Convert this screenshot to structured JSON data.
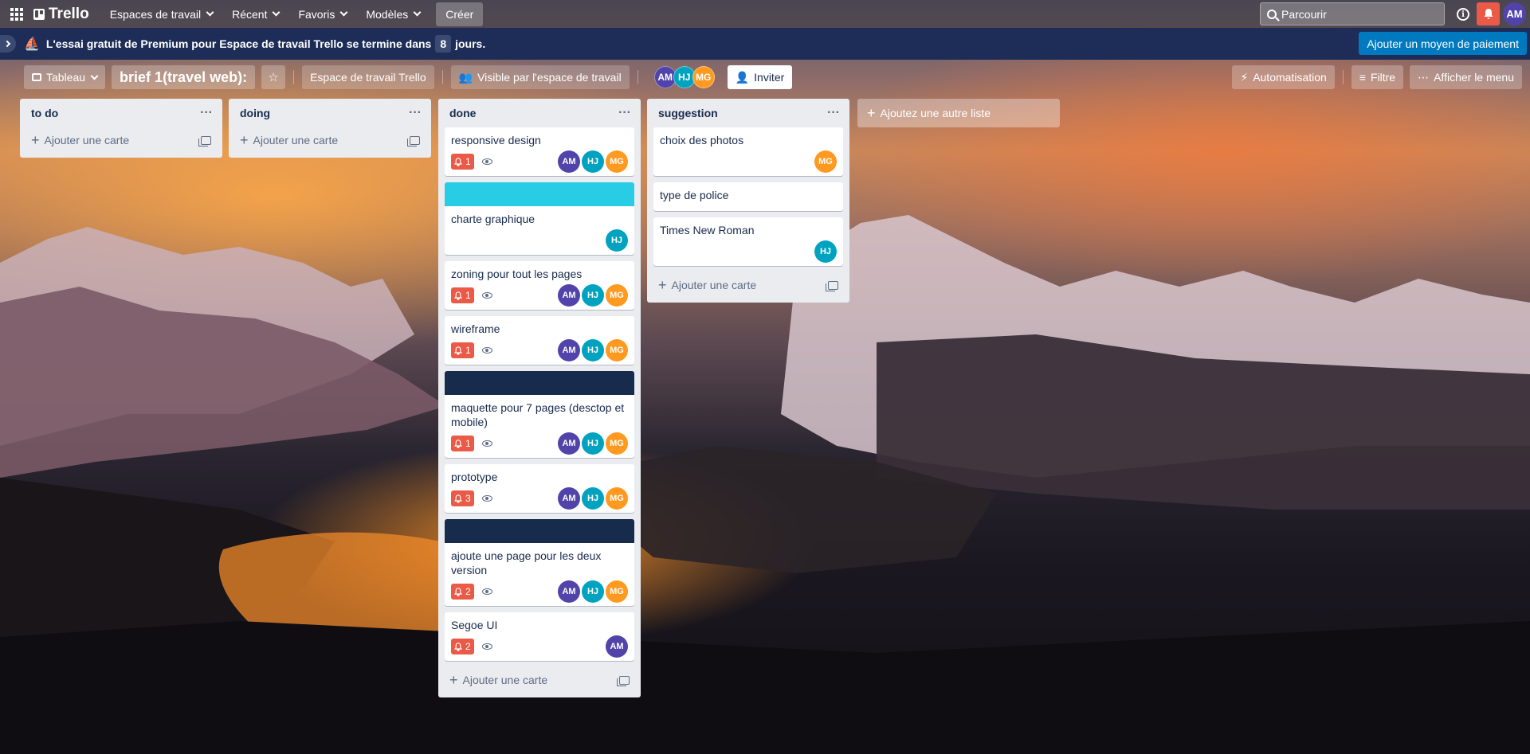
{
  "colors": {
    "purple": "#5243aa",
    "teal": "#00a3bf",
    "orange": "#ff991f",
    "danger": "#eb5a46",
    "banner": "#1d2d57",
    "primary": "#0079bf",
    "cover_cyan": "#29cce5",
    "cover_navy": "#172b4d"
  },
  "topnav": {
    "logo": "Trello",
    "menu": [
      "Espaces de travail",
      "Récent",
      "Favoris",
      "Modèles"
    ],
    "create": "Créer",
    "search_placeholder": "Parcourir",
    "avatar": "AM"
  },
  "banner": {
    "text_before": "L'essai gratuit de Premium pour Espace de travail Trello se termine dans",
    "days": "8",
    "text_after": "jours.",
    "button": "Ajouter un moyen de paiement"
  },
  "board_header": {
    "view": "Tableau",
    "title": "brief 1(travel web):",
    "workspace": "Espace de travail Trello",
    "visibility": "Visible par l'espace de travail",
    "members": [
      "AM",
      "HJ",
      "MG"
    ],
    "invite": "Inviter",
    "automation": "Automatisation",
    "filter": "Filtre",
    "menu": "Afficher le menu"
  },
  "add_card_label": "Ajouter une carte",
  "add_list_label": "Ajoutez une autre liste",
  "lists": [
    {
      "title": "to do",
      "cards": []
    },
    {
      "title": "doing",
      "cards": []
    },
    {
      "title": "done",
      "cards": [
        {
          "title": "responsive design",
          "cover": null,
          "due": "1",
          "watch": true,
          "members": [
            "AM",
            "HJ",
            "MG"
          ]
        },
        {
          "title": "charte graphique",
          "cover": "cyan",
          "due": null,
          "watch": false,
          "members": [
            "HJ"
          ]
        },
        {
          "title": "zoning pour tout les pages",
          "cover": null,
          "due": "1",
          "watch": true,
          "members": [
            "AM",
            "HJ",
            "MG"
          ]
        },
        {
          "title": "wireframe",
          "cover": null,
          "due": "1",
          "watch": true,
          "members": [
            "AM",
            "HJ",
            "MG"
          ]
        },
        {
          "title": "maquette pour 7 pages (desctop et mobile)",
          "cover": "navy",
          "due": "1",
          "watch": true,
          "members": [
            "AM",
            "HJ",
            "MG"
          ]
        },
        {
          "title": "prototype",
          "cover": null,
          "due": "3",
          "watch": true,
          "members": [
            "AM",
            "HJ",
            "MG"
          ]
        },
        {
          "title": "ajoute une page pour les deux version",
          "cover": "navy",
          "due": "2",
          "watch": true,
          "members": [
            "AM",
            "HJ",
            "MG"
          ]
        },
        {
          "title": "Segoe UI",
          "cover": null,
          "due": "2",
          "watch": true,
          "members": [
            "AM"
          ]
        }
      ]
    },
    {
      "title": "suggestion",
      "cards": [
        {
          "title": "choix des photos",
          "cover": null,
          "due": null,
          "watch": false,
          "members": [
            "MG"
          ]
        },
        {
          "title": "type de police",
          "cover": null,
          "due": null,
          "watch": false,
          "members": []
        },
        {
          "title": "Times New Roman",
          "cover": null,
          "due": null,
          "watch": false,
          "members": [
            "HJ"
          ]
        }
      ]
    }
  ]
}
